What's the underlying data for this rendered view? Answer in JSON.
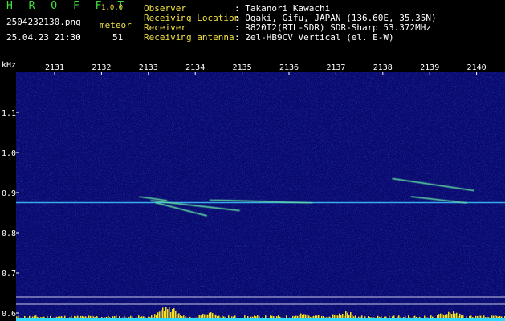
{
  "header": {
    "brand": "H R O F F T",
    "version": "1.0.0",
    "filename": "2504232130.png",
    "datetime": "25.04.23 21:30",
    "meteor_label": "meteor",
    "meteor_count": "51",
    "fields": [
      {
        "label": "Observer",
        "value": ": Takanori Kawachi"
      },
      {
        "label": "Receiving Location",
        "value": ": Ogaki, Gifu, JAPAN (136.60E, 35.35N)"
      },
      {
        "label": "Receiver",
        "value": ": R820T2(RTL-SDR) SDR-Sharp 53.372MHz"
      },
      {
        "label": "Receiving antenna",
        "value": ": 2el-HB9CV Vertical (el. E-W)"
      }
    ]
  },
  "colors": {
    "background": "#000000",
    "spectrum_bg": "#0a0a6e",
    "brand_green": "#3fe03f",
    "label_yellow": "#f0e040",
    "carrier_cyan": "#40c8ff",
    "meteor_green": "#60e0a0",
    "bottom_bar": "#f5e020"
  },
  "chart_data": {
    "type": "heatmap",
    "y_unit_label": "kHz",
    "x_ticks": [
      "2131",
      "2132",
      "2133",
      "2134",
      "2135",
      "2136",
      "2137",
      "2138",
      "2139",
      "2140"
    ],
    "y_ticks": [
      "1.1",
      "1.0",
      "0.9",
      "0.8",
      "0.7",
      "0.6"
    ],
    "ylim": [
      0.58,
      1.2
    ],
    "carrier_khz": 0.875,
    "meteor_traces": [
      {
        "start_min": 2133.05,
        "end_min": 2134.95,
        "start_khz": 0.88,
        "end_khz": 0.855
      },
      {
        "start_min": 2133.15,
        "end_min": 2134.25,
        "start_khz": 0.875,
        "end_khz": 0.842
      },
      {
        "start_min": 2132.8,
        "end_min": 2133.4,
        "start_khz": 0.89,
        "end_khz": 0.88
      },
      {
        "start_min": 2134.3,
        "end_min": 2136.5,
        "start_khz": 0.882,
        "end_khz": 0.874
      },
      {
        "start_min": 2138.2,
        "end_min": 2139.95,
        "start_khz": 0.935,
        "end_khz": 0.905
      },
      {
        "start_min": 2138.6,
        "end_min": 2139.8,
        "start_khz": 0.89,
        "end_khz": 0.874
      }
    ]
  }
}
